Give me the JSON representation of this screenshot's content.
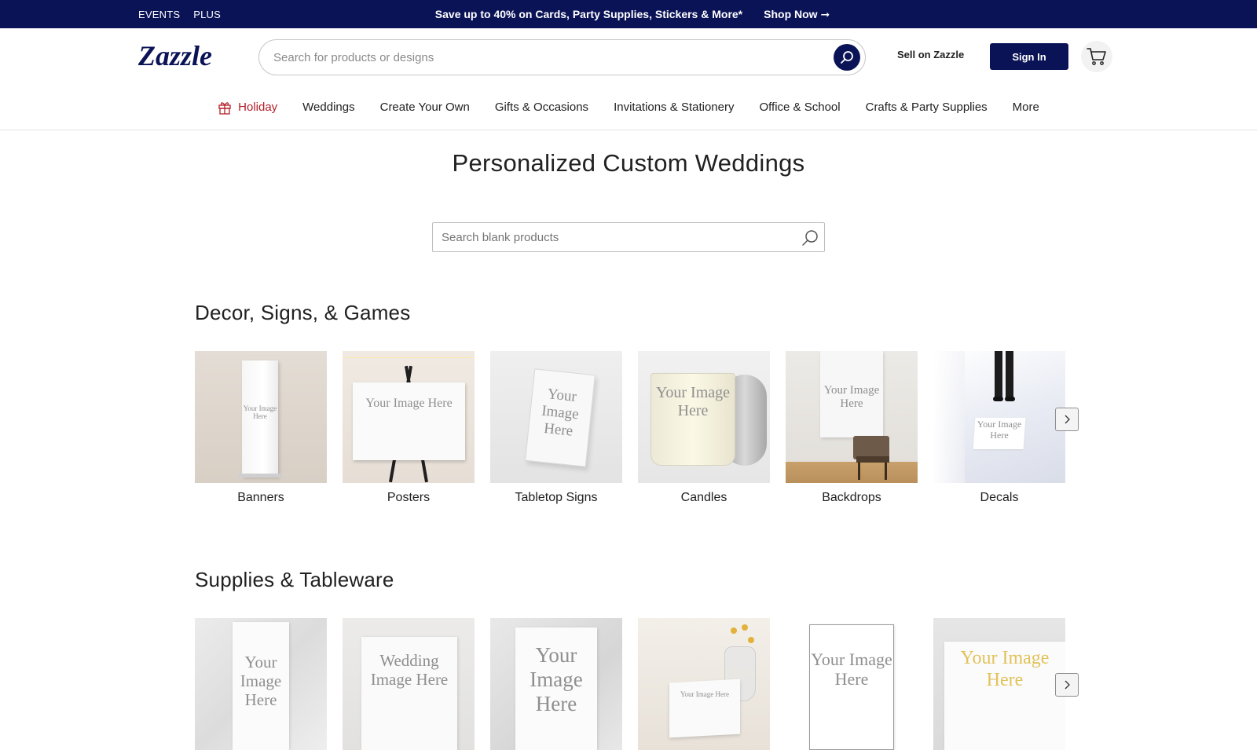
{
  "promo": {
    "events": "EVENTS",
    "plus": "PLUS",
    "message": "Save up to 40% on Cards, Party Supplies, Stickers & More*",
    "shop_now": "Shop Now ➞"
  },
  "header": {
    "logo": "Zazzle",
    "search_placeholder": "Search for products or designs",
    "sell": "Sell on Zazzle",
    "sign_in": "Sign In"
  },
  "nav": {
    "items": [
      "Holiday",
      "Weddings",
      "Create Your Own",
      "Gifts & Occasions",
      "Invitations & Stationery",
      "Office & School",
      "Crafts & Party Supplies",
      "More"
    ]
  },
  "main": {
    "title": "Personalized Custom Weddings",
    "search_placeholder": "Search blank products"
  },
  "sections": [
    {
      "title": "Decor, Signs, & Games",
      "items": [
        {
          "label": "Banners",
          "img_text": "Your Image Here"
        },
        {
          "label": "Posters",
          "img_text": "Your Image Here"
        },
        {
          "label": "Tabletop Signs",
          "img_text": "Your Image Here"
        },
        {
          "label": "Candles",
          "img_text": "Your Image Here"
        },
        {
          "label": "Backdrops",
          "img_text": "Your Image Here"
        },
        {
          "label": "Decals",
          "img_text": "Your Image Here"
        }
      ]
    },
    {
      "title": "Supplies & Tableware",
      "items": [
        {
          "img_text": "Your Image Here"
        },
        {
          "img_text": "Wedding Image Here"
        },
        {
          "img_text": "Your Image Here"
        },
        {
          "img_text": "Your Image Here"
        },
        {
          "img_text": "Your Image Here"
        },
        {
          "img_text": "Your Image Here"
        }
      ]
    }
  ],
  "colors": {
    "navy": "#0b1357",
    "holiday_red": "#b3202a"
  }
}
